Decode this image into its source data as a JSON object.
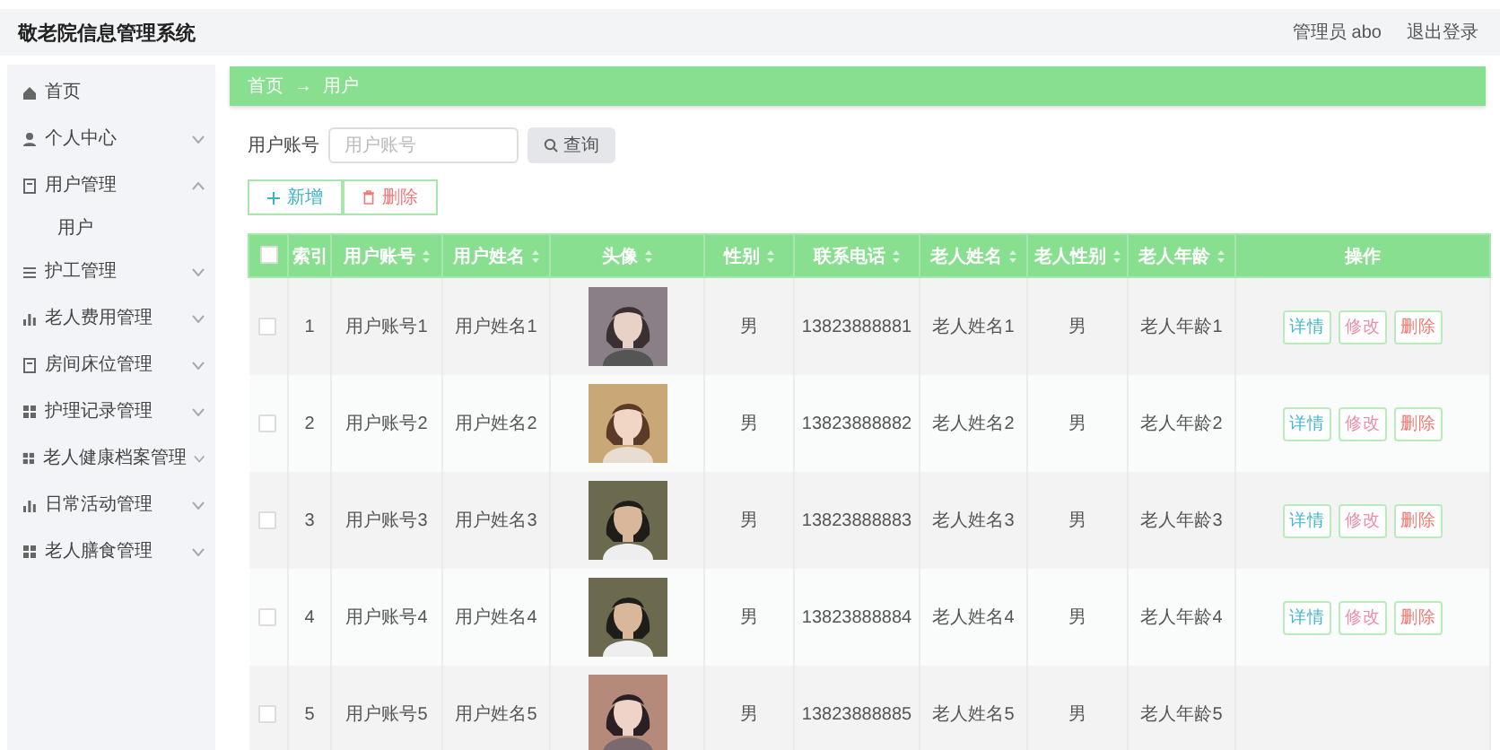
{
  "header": {
    "title": "敬老院信息管理系统",
    "user": "管理员 abo",
    "logout": "退出登录"
  },
  "sidebar": {
    "items": [
      {
        "label": "首页",
        "expandable": false
      },
      {
        "label": "个人中心",
        "expandable": true,
        "expanded": false
      },
      {
        "label": "用户管理",
        "expandable": true,
        "expanded": true,
        "children": [
          {
            "label": "用户"
          }
        ]
      },
      {
        "label": "护工管理",
        "expandable": true,
        "expanded": false
      },
      {
        "label": "老人费用管理",
        "expandable": true,
        "expanded": false
      },
      {
        "label": "房间床位管理",
        "expandable": true,
        "expanded": false
      },
      {
        "label": "护理记录管理",
        "expandable": true,
        "expanded": false
      },
      {
        "label": "老人健康档案管理",
        "expandable": true,
        "expanded": false
      },
      {
        "label": "日常活动管理",
        "expandable": true,
        "expanded": false
      },
      {
        "label": "老人膳食管理",
        "expandable": true,
        "expanded": false
      }
    ]
  },
  "breadcrumb": {
    "items": [
      "首页",
      "用户"
    ],
    "separator": "→"
  },
  "search": {
    "label": "用户账号",
    "placeholder": "用户账号",
    "button": "查询"
  },
  "toolbar": [
    {
      "kind": "add",
      "label": "新增"
    },
    {
      "kind": "delete",
      "label": "删除"
    }
  ],
  "table": {
    "select_all": {
      "checked": false
    },
    "columns": [
      {
        "label": "索引",
        "sortable": false
      },
      {
        "label": "用户账号",
        "sortable": true
      },
      {
        "label": "用户姓名",
        "sortable": true
      },
      {
        "label": "头像",
        "sortable": true
      },
      {
        "label": "性别",
        "sortable": true
      },
      {
        "label": "联系电话",
        "sortable": true
      },
      {
        "label": "老人姓名",
        "sortable": true
      },
      {
        "label": "老人性别",
        "sortable": true
      },
      {
        "label": "老人年龄",
        "sortable": true
      },
      {
        "label": "操作",
        "sortable": false
      }
    ],
    "rows": [
      {
        "checked": false,
        "cells": [
          "1",
          "用户账号1",
          "用户姓名1",
          {
            "kind": "picture"
          },
          "男",
          "13823888881",
          "老人姓名1",
          "男",
          "老人年龄1"
        ],
        "actions": [
          {
            "kind": "detail",
            "label": "详情"
          },
          {
            "kind": "edit",
            "label": "修改"
          },
          {
            "kind": "delete",
            "label": "删除"
          }
        ]
      },
      {
        "checked": false,
        "cells": [
          "2",
          "用户账号2",
          "用户姓名2",
          {
            "kind": "picture"
          },
          "男",
          "13823888882",
          "老人姓名2",
          "男",
          "老人年龄2"
        ],
        "actions": [
          {
            "kind": "detail",
            "label": "详情"
          },
          {
            "kind": "edit",
            "label": "修改"
          },
          {
            "kind": "delete",
            "label": "删除"
          }
        ]
      },
      {
        "checked": false,
        "cells": [
          "3",
          "用户账号3",
          "用户姓名3",
          {
            "kind": "picture"
          },
          "男",
          "13823888883",
          "老人姓名3",
          "男",
          "老人年龄3"
        ],
        "actions": [
          {
            "kind": "detail",
            "label": "详情"
          },
          {
            "kind": "edit",
            "label": "修改"
          },
          {
            "kind": "delete",
            "label": "删除"
          }
        ]
      },
      {
        "checked": false,
        "cells": [
          "4",
          "用户账号4",
          "用户姓名4",
          {
            "kind": "picture"
          },
          "男",
          "13823888884",
          "老人姓名4",
          "男",
          "老人年龄4"
        ],
        "actions": [
          {
            "kind": "detail",
            "label": "详情"
          },
          {
            "kind": "edit",
            "label": "修改"
          },
          {
            "kind": "delete",
            "label": "删除"
          }
        ]
      },
      {
        "checked": false,
        "cells": [
          "5",
          "用户账号5",
          "用户姓名5",
          {
            "kind": "picture"
          },
          "男",
          "13823888885",
          "老人姓名5",
          "男",
          "老人年龄5"
        ],
        "actions": []
      }
    ]
  }
}
